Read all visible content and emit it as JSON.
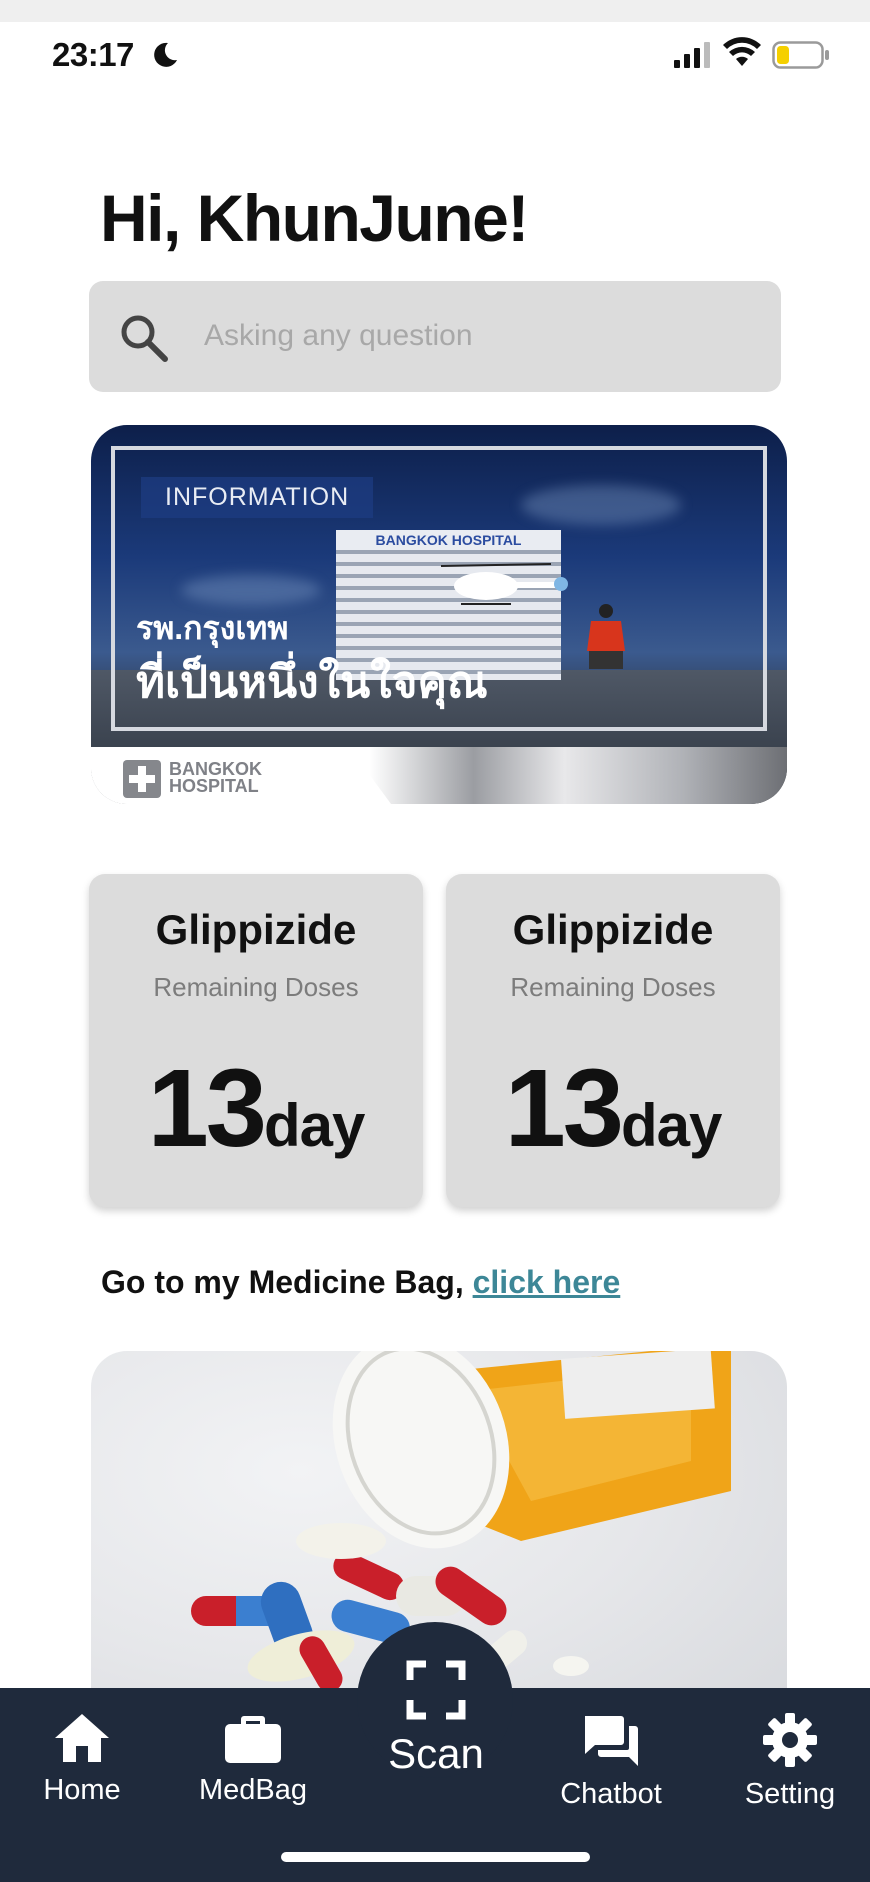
{
  "status_bar": {
    "time": "23:17"
  },
  "greeting": "Hi, KhunJune!",
  "search": {
    "placeholder": "Asking any question"
  },
  "banner": {
    "tag": "INFORMATION",
    "building_sign": "BANGKOK HOSPITAL",
    "thai_line1": "รพ.กรุงเทพ",
    "thai_line2": "ที่เป็นหนึ่งในใจคุณ",
    "logo_text_1": "BANGKOK",
    "logo_text_2": "HOSPITAL"
  },
  "doses": [
    {
      "drug": "Glippizide",
      "subtitle": "Remaining Doses",
      "value": "13",
      "unit": "day"
    },
    {
      "drug": "Glippizide",
      "subtitle": "Remaining Doses",
      "value": "13",
      "unit": "day"
    }
  ],
  "medbag_prompt": {
    "text": "Go to my Medicine Bag, ",
    "link": "click here"
  },
  "nav": {
    "home": "Home",
    "medbag": "MedBag",
    "scan": "Scan",
    "chatbot": "Chatbot",
    "setting": "Setting"
  },
  "colors": {
    "nav_bg": "#1f2a3c",
    "link": "#3d8797",
    "card_bg": "#dcdcdc",
    "battery_level": "#f5d000"
  },
  "status_icons": [
    "moon-icon",
    "signal-icon",
    "wifi-icon",
    "battery-icon"
  ]
}
